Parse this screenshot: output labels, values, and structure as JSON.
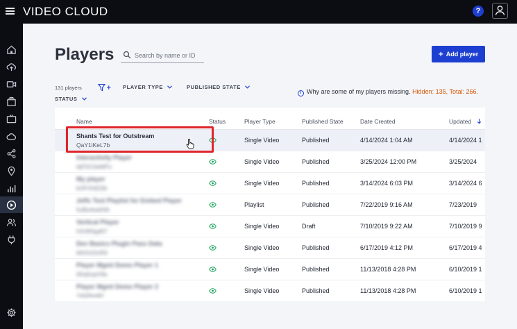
{
  "app": {
    "brand": "VIDEO CLOUD",
    "help_label": "?"
  },
  "sidebar": {
    "items": [
      {
        "name": "home-icon"
      },
      {
        "name": "upload-icon"
      },
      {
        "name": "video-icon"
      },
      {
        "name": "media-icon"
      },
      {
        "name": "tv-icon"
      },
      {
        "name": "cloud-icon"
      },
      {
        "name": "share-icon"
      },
      {
        "name": "location-icon"
      },
      {
        "name": "analytics-icon"
      },
      {
        "name": "players-icon",
        "active": true
      },
      {
        "name": "users-icon"
      },
      {
        "name": "plugin-icon"
      },
      {
        "name": "settings-icon"
      }
    ]
  },
  "page": {
    "title": "Players",
    "search_placeholder": "Search by name or ID",
    "add_button": "Add player",
    "count": "131 players",
    "filters": {
      "player_type": "PLAYER TYPE",
      "published_state": "PUBLISHED STATE",
      "status": "STATUS"
    },
    "missing_question": "Why are some of my players missing.",
    "missing_counts": "Hidden: 135, Total: 266."
  },
  "table": {
    "headers": {
      "name": "Name",
      "status": "Status",
      "player_type": "Player Type",
      "published_state": "Published State",
      "date_created": "Date Created",
      "updated": "Updated"
    },
    "rows": [
      {
        "name": "Shants Test for Outstream",
        "id": "QaY1iKeL7b",
        "type": "Single Video",
        "state": "Published",
        "created": "4/14/2024 1:04 AM",
        "updated": "4/14/2024 1"
      },
      {
        "name": "Interactivity Player",
        "id": "hjFDC0aWFs",
        "type": "Single Video",
        "state": "Published",
        "created": "3/25/2024 12:00 PM",
        "updated": "3/25/2024"
      },
      {
        "name": "My player",
        "id": "kOFX5iDZb",
        "type": "Single Video",
        "state": "Published",
        "created": "3/14/2024 6:03 PM",
        "updated": "3/14/2024 6"
      },
      {
        "name": "Jeffs Test Playlist for Embed Player",
        "id": "5xBs4wdrNh",
        "type": "Playlist",
        "state": "Published",
        "created": "7/22/2019 9:16 AM",
        "updated": "7/23/2019"
      },
      {
        "name": "Vertical Player",
        "id": "hXrMSgd07",
        "type": "Single Video",
        "state": "Draft",
        "created": "7/10/2019 9:22 AM",
        "updated": "7/10/2019 9"
      },
      {
        "name": "Dev Basics Plugin Pass Data",
        "id": "bKtOcDcR0",
        "type": "Single Video",
        "state": "Published",
        "created": "6/17/2019 4:12 PM",
        "updated": "6/17/2019 4"
      },
      {
        "name": "Player Mgmt Demo Player 1",
        "id": "0Dq5xpV9a",
        "type": "Single Video",
        "state": "Published",
        "created": "11/13/2018 4:28 PM",
        "updated": "6/10/2019 1"
      },
      {
        "name": "Player Mgmt Demo Player 2",
        "id": "7dQfAw82",
        "type": "Single Video",
        "state": "Published",
        "created": "11/13/2018 4:28 PM",
        "updated": "6/10/2019 1"
      }
    ]
  },
  "colors": {
    "accent": "#1d3fd1",
    "highlight": "#e0262b",
    "warning": "#d35400",
    "status_eye": "#19a35b"
  }
}
